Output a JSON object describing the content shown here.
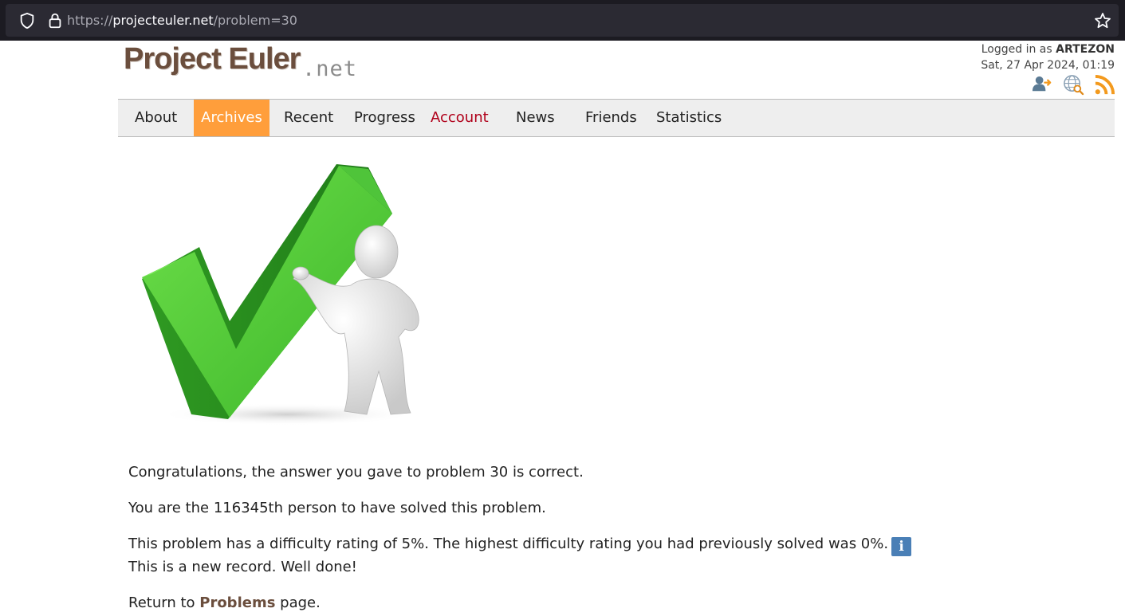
{
  "browser": {
    "url_prefix": "https://",
    "url_domain": "projecteuler.net",
    "url_path": "/problem=30"
  },
  "logo": {
    "main": "Project Euler",
    "suffix": ".net"
  },
  "user": {
    "logged_in_prefix": "Logged in as ",
    "username": "ARTEZON",
    "datetime": "Sat, 27 Apr 2024, 01:19",
    "icons": [
      "user-logout-icon",
      "globe-search-icon",
      "rss-icon"
    ]
  },
  "nav": {
    "items": [
      {
        "label": "About"
      },
      {
        "label": "Archives"
      },
      {
        "label": "Recent"
      },
      {
        "label": "Progress"
      },
      {
        "label": "Account"
      },
      {
        "label": "News"
      },
      {
        "label": "Friends"
      },
      {
        "label": "Statistics"
      }
    ],
    "active": "Archives",
    "colors": {
      "active_bg": "#ff9e3b",
      "account": "#b0001a"
    }
  },
  "result": {
    "congrats": "Congratulations, the answer you gave to problem 30 is correct.",
    "solver": "You are the 116345th person to have solved this problem.",
    "difficulty": "This problem has a difficulty rating of 5%. The highest difficulty rating you had previously solved was 0%.",
    "info_glyph": "i",
    "record": "This is a new record. Well done!",
    "return_prefix": "Return to ",
    "return_link": "Problems",
    "return_suffix": " page."
  }
}
